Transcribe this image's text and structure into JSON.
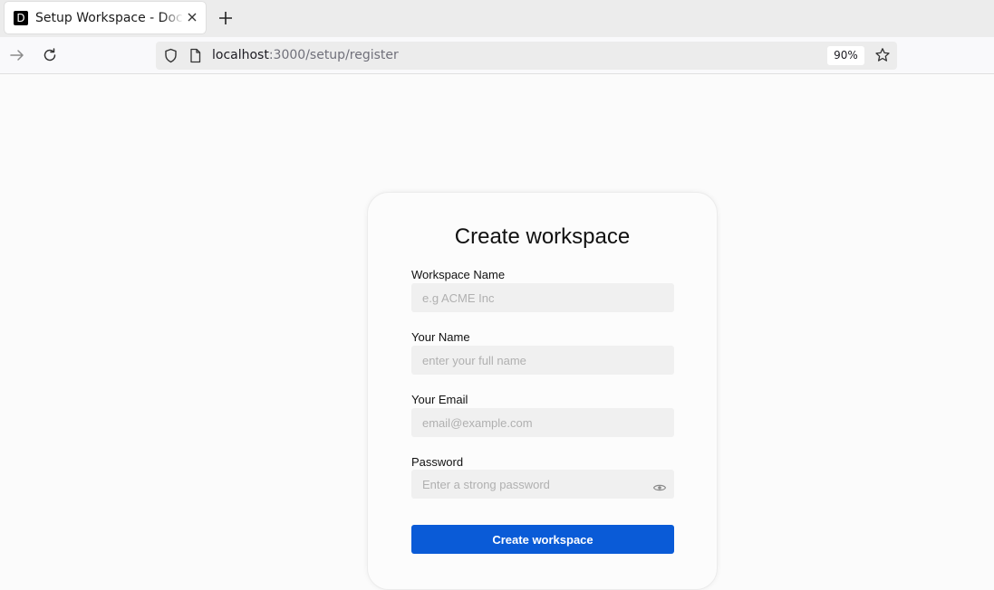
{
  "browser": {
    "tab_title": "Setup Workspace - Documenso",
    "tab_favicon_letter": "D",
    "url_host": "localhost",
    "url_path": ":3000/setup/register",
    "zoom": "90%"
  },
  "form": {
    "title": "Create workspace",
    "workspace_name": {
      "label": "Workspace Name",
      "placeholder": "e.g ACME Inc",
      "value": ""
    },
    "your_name": {
      "label": "Your Name",
      "placeholder": "enter your full name",
      "value": ""
    },
    "your_email": {
      "label": "Your Email",
      "placeholder": "email@example.com",
      "value": ""
    },
    "password": {
      "label": "Password",
      "placeholder": "Enter a strong password",
      "value": ""
    },
    "submit_label": "Create workspace"
  },
  "colors": {
    "primary_button": "#0a5bd7",
    "input_bg": "#f0f0f0",
    "page_bg": "#fbfbfb"
  },
  "icons": {
    "tab_close": "close-icon",
    "new_tab": "plus-icon",
    "back": "arrow-right-icon",
    "reload": "reload-icon",
    "shield": "shield-icon",
    "page": "page-icon",
    "bookmark": "star-icon",
    "password_toggle": "eye-icon"
  }
}
